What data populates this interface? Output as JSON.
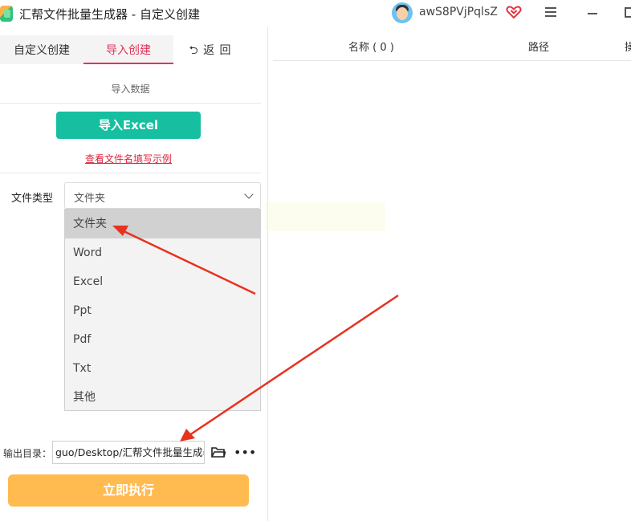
{
  "window": {
    "title": "汇帮文件批量生成器 - 自定义创建",
    "username": "awS8PVjPqlsZ"
  },
  "tabs": {
    "custom": "自定义创建",
    "import": "导入创建",
    "back": "⮌ 返 回"
  },
  "import_section": {
    "label": "导入数据",
    "import_button": "导入Excel",
    "example_link": "查看文件名填写示例"
  },
  "file_type": {
    "label": "文件类型",
    "selected": "文件夹",
    "options": [
      "文件夹",
      "Word",
      "Excel",
      "Ppt",
      "Pdf",
      "Txt",
      "其他"
    ]
  },
  "output": {
    "label": "输出目录：",
    "value": "guo/Desktop/汇帮文件批量生成器"
  },
  "run_button": "立即执行",
  "table": {
    "col_name": "名称 ( 0 )",
    "col_path": "路径",
    "col_op": "操"
  },
  "colors": {
    "accent_pink": "#e0335a",
    "teal_button": "#16bfa0",
    "orange_button": "#ffbb50",
    "annotation_arrow": "#e8321e"
  },
  "icons": [
    "app-logo-icon",
    "avatar",
    "vip-heart-icon",
    "menu-icon",
    "minimize-icon",
    "maximize-icon",
    "back-arrow-icon",
    "chevron-down-icon",
    "folder-icon",
    "more-icon"
  ]
}
